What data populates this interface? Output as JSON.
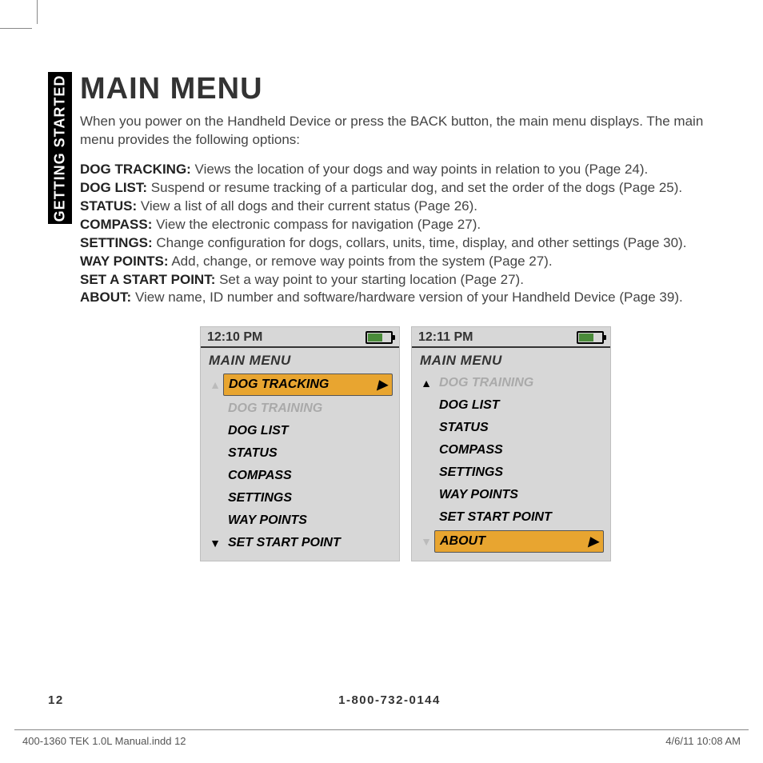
{
  "sideTab": "GETTING STARTED",
  "title": "MAIN MENU",
  "intro": "When you power on the Handheld Device or press the BACK button, the main menu displays. The main menu provides the following options:",
  "definitions": [
    {
      "term": "DOG TRACKING:",
      "desc": " Views the location of your dogs and way points in relation to you (Page 24)."
    },
    {
      "term": "DOG LIST:",
      "desc": " Suspend or resume tracking of a particular dog, and set the order of the dogs (Page 25)."
    },
    {
      "term": "STATUS:",
      "desc": " View a list of all dogs and their current status (Page 26)."
    },
    {
      "term": "COMPASS:",
      "desc": " View the electronic compass for navigation (Page 27)."
    },
    {
      "term": "SETTINGS:",
      "desc": " Change configuration for dogs, collars, units, time, display, and other settings (Page 30)."
    },
    {
      "term": "WAY POINTS:",
      "desc": " Add, change, or remove way points from the system (Page 27)."
    },
    {
      "term": "SET A START POINT:",
      "desc": " Set a way point to your starting location (Page 27)."
    },
    {
      "term": "ABOUT:",
      "desc": " View name, ID number and software/hardware version of your Handheld Device (Page 39)."
    }
  ],
  "screens": [
    {
      "time": "12:10 PM",
      "title": "MAIN MENU",
      "upDisabled": true,
      "downDisabled": false,
      "items": [
        {
          "label": "DOG TRACKING",
          "selected": true,
          "disabled": false
        },
        {
          "label": "DOG TRAINING",
          "selected": false,
          "disabled": true
        },
        {
          "label": "DOG LIST",
          "selected": false,
          "disabled": false
        },
        {
          "label": "STATUS",
          "selected": false,
          "disabled": false
        },
        {
          "label": "COMPASS",
          "selected": false,
          "disabled": false
        },
        {
          "label": "SETTINGS",
          "selected": false,
          "disabled": false
        },
        {
          "label": "WAY POINTS",
          "selected": false,
          "disabled": false
        },
        {
          "label": "SET START POINT",
          "selected": false,
          "disabled": false
        }
      ]
    },
    {
      "time": "12:11 PM",
      "title": "MAIN MENU",
      "upDisabled": false,
      "downDisabled": true,
      "items": [
        {
          "label": "DOG TRAINING",
          "selected": false,
          "disabled": true
        },
        {
          "label": "DOG LIST",
          "selected": false,
          "disabled": false
        },
        {
          "label": "STATUS",
          "selected": false,
          "disabled": false
        },
        {
          "label": "COMPASS",
          "selected": false,
          "disabled": false
        },
        {
          "label": "SETTINGS",
          "selected": false,
          "disabled": false
        },
        {
          "label": "WAY POINTS",
          "selected": false,
          "disabled": false
        },
        {
          "label": "SET START POINT",
          "selected": false,
          "disabled": false
        },
        {
          "label": "ABOUT",
          "selected": true,
          "disabled": false
        }
      ]
    }
  ],
  "footer": {
    "page": "12",
    "phone": "1-800-732-0144"
  },
  "slug": {
    "file": "400-1360 TEK 1.0L Manual.indd   12",
    "stamp": "4/6/11   10:08 AM"
  }
}
